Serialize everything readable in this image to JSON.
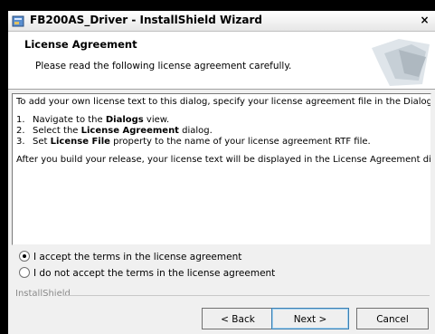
{
  "window": {
    "title": "FB200AS_Driver - InstallShield Wizard",
    "close_label": "×"
  },
  "header": {
    "title": "License Agreement",
    "subtitle": "Please read the following license agreement carefully."
  },
  "license": {
    "intro": "To add your own license text to this dialog, specify your license agreement file in the Dialog View.",
    "steps": [
      {
        "num": "1.",
        "pre": "Navigate to the ",
        "bold": "Dialogs",
        "post": " view."
      },
      {
        "num": "2.",
        "pre": "Select the ",
        "bold": "License Agreement",
        "post": " dialog."
      },
      {
        "num": "3.",
        "pre": "Set ",
        "bold": "License File",
        "post": " property to the name of your license agreement RTF file."
      }
    ],
    "outro": "After you build your release, your license text will be displayed in the License Agreement dialog."
  },
  "options": {
    "accept": "I accept the terms in the license agreement",
    "decline": "I do not accept the terms in the license agreement",
    "selected": "accept"
  },
  "brand": "InstallShield",
  "buttons": {
    "back": "< Back",
    "next": "Next >",
    "cancel": "Cancel"
  }
}
